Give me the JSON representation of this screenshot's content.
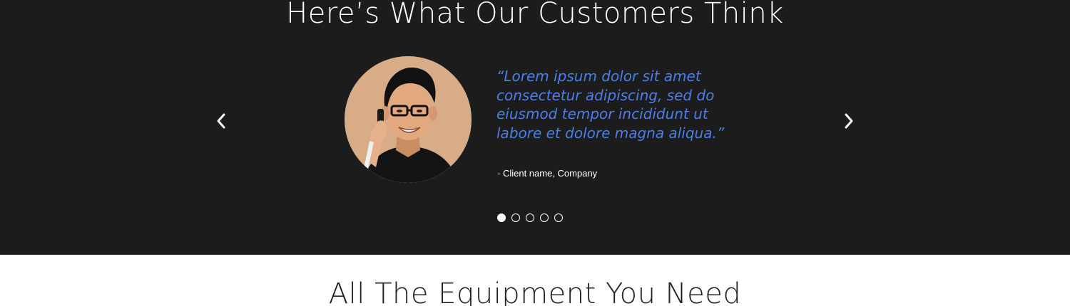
{
  "testimonials": {
    "title": "Here’s What Our Customers Think",
    "quote": "“Lorem ipsum dolor sit amet consectetur adipiscing, sed do eiusmod tempor incididunt ut labore et dolore magna aliqua.”",
    "author": "- Client name, Company",
    "prev_icon": "chevron-left-icon",
    "next_icon": "chevron-right-icon",
    "slide_count": 5,
    "active_slide": 1,
    "colors": {
      "background": "#1c1c1c",
      "quote": "#4b7ee8",
      "text": "#ffffff"
    }
  },
  "equipment": {
    "title": "All The Equipment You Need"
  }
}
